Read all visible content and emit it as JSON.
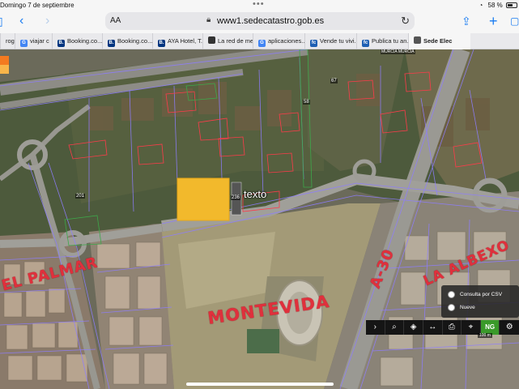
{
  "status": {
    "time_date": "Domingo 7 de septiembre",
    "battery": "58 %"
  },
  "toolbar": {
    "text_size": "AA",
    "url": "www1.sedecatastro.gob.es"
  },
  "tabs": [
    {
      "label": "rog",
      "favicon": "",
      "color": "#888888"
    },
    {
      "label": "viajar c",
      "favicon": "G",
      "color": "#4285f4"
    },
    {
      "label": "Booking.co...",
      "favicon": "B.",
      "color": "#003580"
    },
    {
      "label": "Booking.co...",
      "favicon": "B.",
      "color": "#003580"
    },
    {
      "label": "AYA Hotel, T...",
      "favicon": "B.",
      "color": "#003580"
    },
    {
      "label": "La red de me...",
      "favicon": "",
      "color": "#333333"
    },
    {
      "label": "aplicaciones...",
      "favicon": "G",
      "color": "#4285f4"
    },
    {
      "label": "Vende tu vivi...",
      "favicon": "fc",
      "color": "#1e5fb4"
    },
    {
      "label": "Publica tu an...",
      "favicon": "fc",
      "color": "#1e5fb4"
    },
    {
      "label": "Sede Elec",
      "favicon": "",
      "color": "#555555"
    }
  ],
  "map": {
    "texto_label": "texto",
    "annotations": {
      "palmar": "EL PALMAR",
      "montevida": "MONTEVIDA",
      "a30": "A-30",
      "albatalia": "LA ALBEXO"
    },
    "top_label": "MURCIA MURCIA",
    "parcel_numbers": [
      "201",
      "236",
      "58",
      "67"
    ]
  },
  "panel": {
    "option_csv": "Consulta por CSV",
    "option_nueve": "Nueve"
  },
  "tools": {
    "ng": "NG",
    "scale": "100 m"
  }
}
